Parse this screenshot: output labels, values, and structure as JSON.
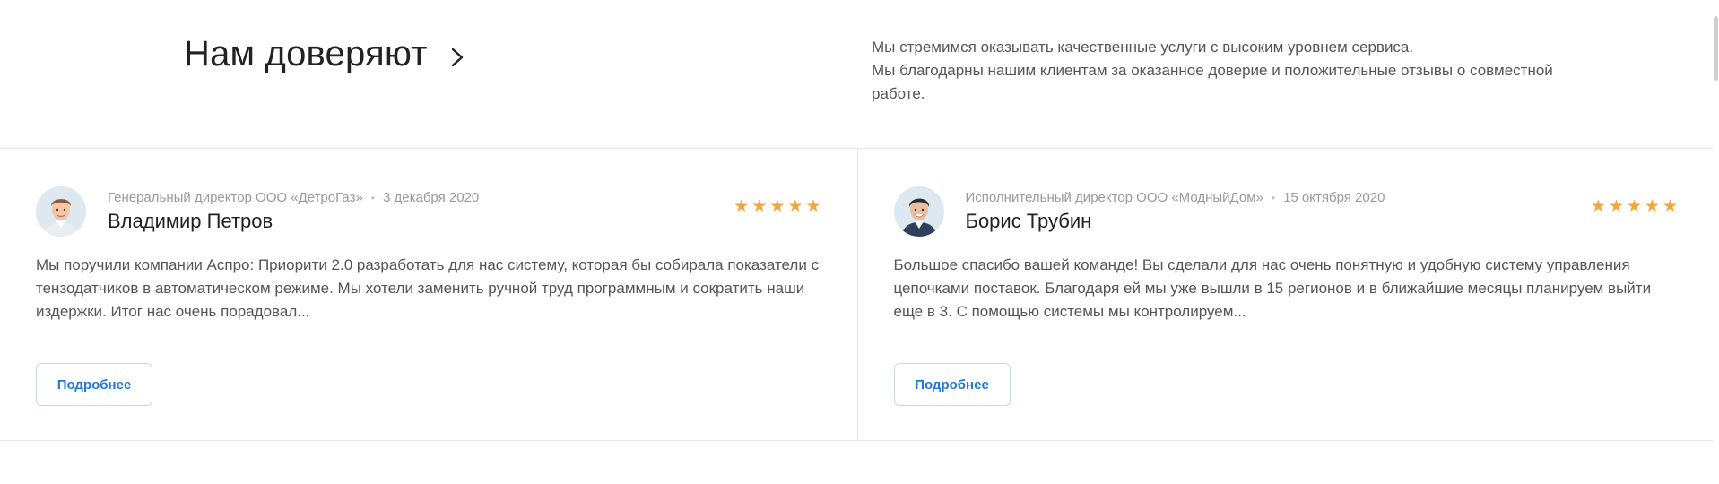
{
  "header": {
    "title": "Нам доверяют",
    "intro_line1": "Мы стремимся оказывать качественные услуги с высоким уровнем сервиса.",
    "intro_line2": "Мы благодарны нашим клиентам за оказанное доверие и положительные отзывы о совместной работе."
  },
  "reviews": [
    {
      "position": "Генеральный директор ООО «ДетроГаз»",
      "date": "3 декабря 2020",
      "name": "Владимир Петров",
      "rating": 5,
      "text": "Мы поручили компании Аспро: Приорити 2.0 разработать для нас систему, которая бы собирала показатели с тензодатчиков в автоматическом режиме. Мы хотели заменить ручной труд программным и сократить наши издержки. Итог нас очень порадовал...",
      "button_label": "Подробнее"
    },
    {
      "position": "Исполнительный директор ООО «МодныйДом»",
      "date": "15 октября 2020",
      "name": "Борис Трубин",
      "rating": 5,
      "text": "Большое спасибо вашей команде! Вы сделали для нас очень понятную и удобную систему управления цепочками поставок. Благодаря ей мы уже вышли в 15 регионов и в ближайшие месяцы планируем выйти еще в 3. С помощью системы мы контролируем...",
      "button_label": "Подробнее"
    }
  ],
  "icons": {
    "title_arrow": "chevron-right-icon",
    "rating": "star-icon",
    "meta_separator": "dot"
  },
  "colors": {
    "star": "#f6a53a",
    "button_text": "#1e7ad6",
    "button_border": "#c7d9ee",
    "divider": "#e6e6e6"
  }
}
